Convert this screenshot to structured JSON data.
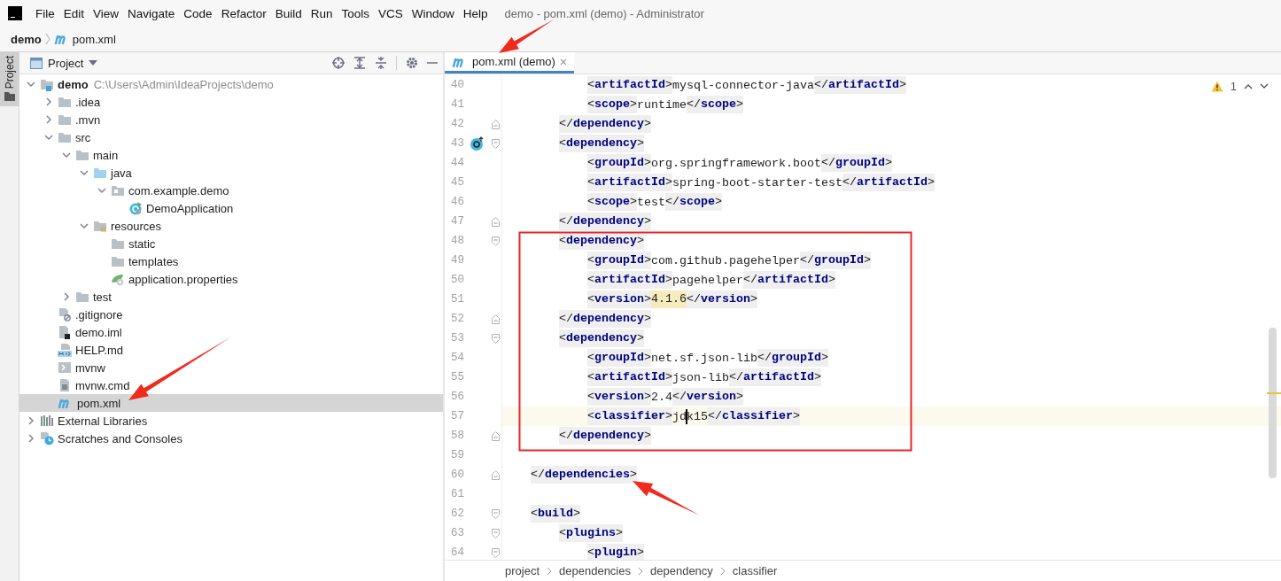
{
  "window": {
    "title": "demo - pom.xml (demo) - Administrator"
  },
  "menu": [
    "File",
    "Edit",
    "View",
    "Navigate",
    "Code",
    "Refactor",
    "Build",
    "Run",
    "Tools",
    "VCS",
    "Window",
    "Help"
  ],
  "navigation_bar": [
    {
      "text": "demo",
      "kind": "project"
    },
    {
      "text": "pom.xml",
      "kind": "maven"
    }
  ],
  "tool_stripe": [
    {
      "label": "Project",
      "selected": true
    }
  ],
  "project_panel": {
    "title": "Project",
    "tree": [
      {
        "label": "demo",
        "kind": "module",
        "note": "C:\\Users\\Admin\\IdeaProjects\\demo",
        "expanded": true,
        "selected": false,
        "children": [
          {
            "label": ".idea",
            "kind": "folder",
            "expanded": false,
            "selected": false
          },
          {
            "label": ".mvn",
            "kind": "folder",
            "expanded": false,
            "selected": false
          },
          {
            "label": "src",
            "kind": "folder",
            "expanded": true,
            "selected": false,
            "children": [
              {
                "label": "main",
                "kind": "folder",
                "expanded": true,
                "selected": false,
                "children": [
                  {
                    "label": "java",
                    "kind": "source-folder",
                    "expanded": true,
                    "selected": false,
                    "children": [
                      {
                        "label": "com.example.demo",
                        "kind": "package",
                        "expanded": true,
                        "selected": false,
                        "children": [
                          {
                            "label": "DemoApplication",
                            "kind": "class",
                            "selected": false
                          }
                        ]
                      }
                    ]
                  },
                  {
                    "label": "resources",
                    "kind": "resources-folder",
                    "expanded": true,
                    "selected": false,
                    "children": [
                      {
                        "label": "static",
                        "kind": "folder",
                        "selected": false
                      },
                      {
                        "label": "templates",
                        "kind": "folder",
                        "selected": false
                      },
                      {
                        "label": "application.properties",
                        "kind": "properties",
                        "selected": false
                      }
                    ]
                  }
                ]
              },
              {
                "label": "test",
                "kind": "folder",
                "expanded": false,
                "selected": false
              }
            ]
          },
          {
            "label": ".gitignore",
            "kind": "gitignore",
            "selected": false
          },
          {
            "label": "demo.iml",
            "kind": "iml",
            "selected": false
          },
          {
            "label": "HELP.md",
            "kind": "markdown",
            "selected": false
          },
          {
            "label": "mvnw",
            "kind": "script",
            "selected": false
          },
          {
            "label": "mvnw.cmd",
            "kind": "text",
            "selected": false
          },
          {
            "label": "pom.xml",
            "kind": "maven",
            "selected": true
          }
        ]
      },
      {
        "label": "External Libraries",
        "kind": "libraries",
        "expanded": false,
        "selected": false
      },
      {
        "label": "Scratches and Consoles",
        "kind": "scratches",
        "expanded": false,
        "selected": false
      }
    ]
  },
  "editor": {
    "tabs": [
      {
        "label": "pom.xml (demo)",
        "selected": true
      }
    ],
    "inspection": {
      "count": "1"
    },
    "lines": [
      {
        "number": "40",
        "current": false,
        "tokens": [
          {
            "kind": "open-tag",
            "parts": [
              "<",
              "artifactId",
              ">"
            ]
          },
          {
            "kind": "value",
            "text": "mysql-connector-java"
          },
          {
            "kind": "close-tag",
            "parts": [
              "</",
              "artifactId",
              ">"
            ]
          }
        ]
      },
      {
        "number": "41",
        "current": false,
        "tokens": [
          {
            "kind": "open-tag",
            "parts": [
              "<",
              "scope",
              ">"
            ]
          },
          {
            "kind": "value",
            "text": "runtime"
          },
          {
            "kind": "close-tag",
            "parts": [
              "</",
              "scope",
              ">"
            ]
          }
        ]
      },
      {
        "number": "42",
        "current": false,
        "fold": {
          "kind": "end"
        },
        "tokens": [
          {
            "kind": "close-tag",
            "parts": [
              "</",
              "dependency",
              ">"
            ]
          }
        ]
      },
      {
        "number": "43",
        "current": false,
        "fold": {
          "kind": "start"
        },
        "gutter_icon": true,
        "tokens": [
          {
            "kind": "open-tag",
            "parts": [
              "<",
              "dependency",
              ">"
            ]
          }
        ]
      },
      {
        "number": "44",
        "current": false,
        "tokens": [
          {
            "kind": "open-tag",
            "parts": [
              "<",
              "groupId",
              ">"
            ]
          },
          {
            "kind": "value",
            "text": "org.springframework.boot"
          },
          {
            "kind": "close-tag",
            "parts": [
              "</",
              "groupId",
              ">"
            ]
          }
        ]
      },
      {
        "number": "45",
        "current": false,
        "tokens": [
          {
            "kind": "open-tag",
            "parts": [
              "<",
              "artifactId",
              ">"
            ]
          },
          {
            "kind": "value",
            "text": "spring-boot-starter-test"
          },
          {
            "kind": "close-tag",
            "parts": [
              "</",
              "artifactId",
              ">"
            ]
          }
        ]
      },
      {
        "number": "46",
        "current": false,
        "tokens": [
          {
            "kind": "open-tag",
            "parts": [
              "<",
              "scope",
              ">"
            ]
          },
          {
            "kind": "value",
            "text": "test"
          },
          {
            "kind": "close-tag",
            "parts": [
              "</",
              "scope",
              ">"
            ]
          }
        ]
      },
      {
        "number": "47",
        "current": false,
        "fold": {
          "kind": "end"
        },
        "tokens": [
          {
            "kind": "close-tag",
            "parts": [
              "</",
              "dependency",
              ">"
            ]
          }
        ]
      },
      {
        "number": "48",
        "current": false,
        "fold": {
          "kind": "start"
        },
        "tokens": [
          {
            "kind": "open-tag",
            "parts": [
              "<",
              "dependency",
              ">"
            ]
          }
        ]
      },
      {
        "number": "49",
        "current": false,
        "tokens": [
          {
            "kind": "open-tag",
            "parts": [
              "<",
              "groupId",
              ">"
            ]
          },
          {
            "kind": "value",
            "text": "com.github.pagehelper"
          },
          {
            "kind": "close-tag",
            "parts": [
              "</",
              "groupId",
              ">"
            ]
          }
        ]
      },
      {
        "number": "50",
        "current": false,
        "tokens": [
          {
            "kind": "open-tag",
            "parts": [
              "<",
              "artifactId",
              ">"
            ]
          },
          {
            "kind": "value",
            "text": "pagehelper"
          },
          {
            "kind": "close-tag",
            "parts": [
              "</",
              "artifactId",
              ">"
            ]
          }
        ]
      },
      {
        "number": "51",
        "current": false,
        "tokens": [
          {
            "kind": "open-tag",
            "parts": [
              "<",
              "version",
              ">"
            ]
          },
          {
            "kind": "highlight",
            "text": "4.1.6"
          },
          {
            "kind": "close-tag",
            "parts": [
              "</",
              "version",
              ">"
            ]
          }
        ]
      },
      {
        "number": "52",
        "current": false,
        "fold": {
          "kind": "end"
        },
        "tokens": [
          {
            "kind": "close-tag",
            "parts": [
              "</",
              "dependency",
              ">"
            ]
          }
        ]
      },
      {
        "number": "53",
        "current": false,
        "fold": {
          "kind": "start"
        },
        "tokens": [
          {
            "kind": "open-tag",
            "parts": [
              "<",
              "dependency",
              ">"
            ]
          }
        ]
      },
      {
        "number": "54",
        "current": false,
        "tokens": [
          {
            "kind": "open-tag",
            "parts": [
              "<",
              "groupId",
              ">"
            ]
          },
          {
            "kind": "value",
            "text": "net.sf.json-lib"
          },
          {
            "kind": "close-tag",
            "parts": [
              "</",
              "groupId",
              ">"
            ]
          }
        ]
      },
      {
        "number": "55",
        "current": false,
        "tokens": [
          {
            "kind": "open-tag",
            "parts": [
              "<",
              "artifactId",
              ">"
            ]
          },
          {
            "kind": "value",
            "text": "json-lib"
          },
          {
            "kind": "close-tag",
            "parts": [
              "</",
              "artifactId",
              ">"
            ]
          }
        ]
      },
      {
        "number": "56",
        "current": false,
        "tokens": [
          {
            "kind": "open-tag",
            "parts": [
              "<",
              "version",
              ">"
            ]
          },
          {
            "kind": "value",
            "text": "2.4"
          },
          {
            "kind": "close-tag",
            "parts": [
              "</",
              "version",
              ">"
            ]
          }
        ]
      },
      {
        "number": "57",
        "current": true,
        "tokens": [
          {
            "kind": "open-tag",
            "parts": [
              "<",
              "classifier",
              ">"
            ]
          },
          {
            "kind": "value",
            "text": "jd"
          },
          {
            "kind": "caret"
          },
          {
            "kind": "value",
            "text": "k15"
          },
          {
            "kind": "close-tag",
            "parts": [
              "</",
              "classifier",
              ">"
            ]
          }
        ]
      },
      {
        "number": "58",
        "current": false,
        "fold": {
          "kind": "end"
        },
        "tokens": [
          {
            "kind": "close-tag",
            "parts": [
              "</",
              "dependency",
              ">"
            ]
          }
        ]
      },
      {
        "number": "59"
      },
      {
        "number": "60",
        "current": false,
        "fold": {
          "kind": "end"
        },
        "tokens": [
          {
            "kind": "close-tag",
            "parts": [
              "</",
              "dependencies",
              ">"
            ]
          }
        ]
      },
      {
        "number": "61"
      },
      {
        "number": "62",
        "current": false,
        "fold": {
          "kind": "start"
        },
        "tokens": [
          {
            "kind": "open-tag",
            "parts": [
              "<",
              "build",
              ">"
            ]
          }
        ]
      },
      {
        "number": "63",
        "current": false,
        "fold": {
          "kind": "start"
        },
        "tokens": [
          {
            "kind": "open-tag",
            "parts": [
              "<",
              "plugins",
              ">"
            ]
          }
        ]
      },
      {
        "number": "64",
        "current": false,
        "fold": {
          "kind": "start"
        },
        "tokens": [
          {
            "kind": "open-tag",
            "parts": [
              "<",
              "plugin",
              ">"
            ]
          }
        ]
      }
    ],
    "breadcrumbs": [
      "project",
      "dependencies",
      "dependency",
      "classifier"
    ]
  }
}
